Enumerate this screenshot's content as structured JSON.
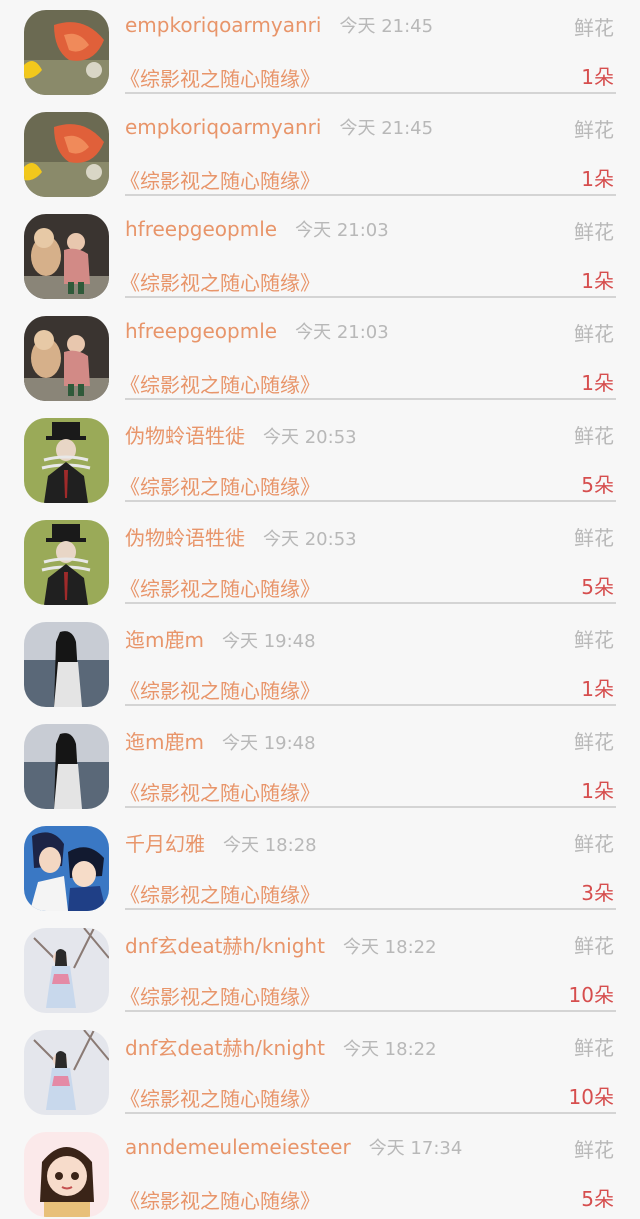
{
  "rows": [
    {
      "username": "empkoriqoarmyanri",
      "time": "今天 21:45",
      "gift_type": "鲜花",
      "book": "《综影视之随心随缘》",
      "count": "1朵",
      "avatar": "koi"
    },
    {
      "username": "empkoriqoarmyanri",
      "time": "今天 21:45",
      "gift_type": "鲜花",
      "book": "《综影视之随心随缘》",
      "count": "1朵",
      "avatar": "koi"
    },
    {
      "username": "hfreepgeopmle",
      "time": "今天 21:03",
      "gift_type": "鲜花",
      "book": "《综影视之随心随缘》",
      "count": "1朵",
      "avatar": "girl-dog"
    },
    {
      "username": "hfreepgeopmle",
      "time": "今天 21:03",
      "gift_type": "鲜花",
      "book": "《综影视之随心随缘》",
      "count": "1朵",
      "avatar": "girl-dog"
    },
    {
      "username": "伪物蛉语牲徙",
      "time": "今天 20:53",
      "gift_type": "鲜花",
      "book": "《综影视之随心随缘》",
      "count": "5朵",
      "avatar": "tophat-man"
    },
    {
      "username": "伪物蛉语牲徙",
      "time": "今天 20:53",
      "gift_type": "鲜花",
      "book": "《综影视之随心随缘》",
      "count": "5朵",
      "avatar": "tophat-man"
    },
    {
      "username": "迤m鹿m",
      "time": "今天 19:48",
      "gift_type": "鲜花",
      "book": "《综影视之随心随缘》",
      "count": "1朵",
      "avatar": "sea-ghost"
    },
    {
      "username": "迤m鹿m",
      "time": "今天 19:48",
      "gift_type": "鲜花",
      "book": "《综影视之随心随缘》",
      "count": "1朵",
      "avatar": "sea-ghost"
    },
    {
      "username": "千月幻雅",
      "time": "今天 18:28",
      "gift_type": "鲜花",
      "book": "《综影视之随心随缘》",
      "count": "3朵",
      "avatar": "anime-boys"
    },
    {
      "username": "dnf玄deat赫h/knight",
      "time": "今天 18:22",
      "gift_type": "鲜花",
      "book": "《综影视之随心随缘》",
      "count": "10朵",
      "avatar": "snow-girl"
    },
    {
      "username": "dnf玄deat赫h/knight",
      "time": "今天 18:22",
      "gift_type": "鲜花",
      "book": "《综影视之随心随缘》",
      "count": "10朵",
      "avatar": "snow-girl"
    },
    {
      "username": "anndemeulemeiesteer",
      "time": "今天 17:34",
      "gift_type": "鲜花",
      "book": "《综影视之随心随缘》",
      "count": "5朵",
      "avatar": "cartoon-girl"
    }
  ]
}
